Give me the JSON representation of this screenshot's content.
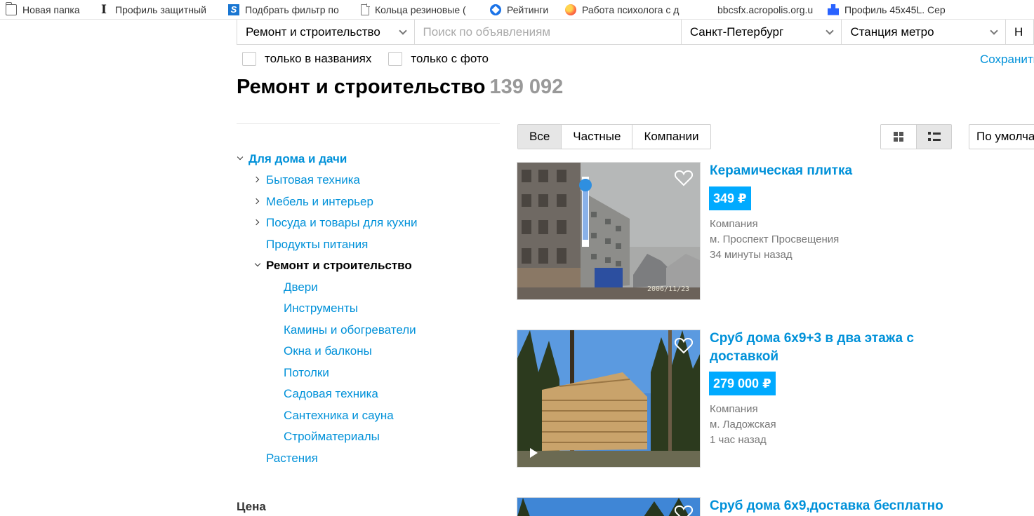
{
  "bookmarks": [
    {
      "label": "Новая папка",
      "icon": "folder-icon"
    },
    {
      "label": "Профиль защитный",
      "icon": "i-beam-icon"
    },
    {
      "label": "Подбрать фильтр по",
      "icon": "s-logo-icon"
    },
    {
      "label": "Кольца резиновые (",
      "icon": "document-icon"
    },
    {
      "label": "Рейтинги",
      "icon": "ratings-icon"
    },
    {
      "label": "Работа психолога с д",
      "icon": "ball-icon"
    },
    {
      "label": "bbcsfx.acropolis.org.u",
      "icon": "none"
    },
    {
      "label": "Профиль 45х45L. Сер",
      "icon": "puzzle-icon"
    }
  ],
  "search": {
    "category": "Ремонт и строительство",
    "placeholder": "Поиск по объявлениям",
    "city": "Санкт-Петербург",
    "metro": "Станция метро",
    "extra": "Н"
  },
  "filters": {
    "titles_only": "только в названиях",
    "with_photo": "только с фото",
    "save_search": "Сохранить"
  },
  "page": {
    "title": "Ремонт и строительство",
    "count": "139 092"
  },
  "sidebar": {
    "parent": "Для дома и дачи",
    "items": [
      {
        "label": "Бытовая техника"
      },
      {
        "label": "Мебель и интерьер"
      },
      {
        "label": "Посуда и товары для кухни"
      },
      {
        "label": "Продукты питания"
      },
      {
        "label": "Ремонт и строительство"
      },
      {
        "label": "Растения"
      }
    ],
    "subitems": [
      {
        "label": "Двери"
      },
      {
        "label": "Инструменты"
      },
      {
        "label": "Камины и обогреватели"
      },
      {
        "label": "Окна и балконы"
      },
      {
        "label": "Потолки"
      },
      {
        "label": "Садовая техника"
      },
      {
        "label": "Сантехника и сауна"
      },
      {
        "label": "Стройматериалы"
      }
    ],
    "price_label": "Цена"
  },
  "tabs": [
    {
      "label": "Все",
      "active": true
    },
    {
      "label": "Частные",
      "active": false
    },
    {
      "label": "Компании",
      "active": false
    }
  ],
  "sort": {
    "value": "По умолча"
  },
  "listings": [
    {
      "title": "Керамическая плитка",
      "price": "349 ₽",
      "seller": "Компания",
      "metro": "м. Проспект Просвещения",
      "time": "34 минуты назад",
      "photo_date": "2006/11/23"
    },
    {
      "title": "Сруб дома 6х9+3 в два этажа с доставкой",
      "price": "279 000 ₽",
      "seller": "Компания",
      "metro": "м. Ладожская",
      "time": "1 час назад"
    },
    {
      "title": "Сруб дома 6х9,доставка бесплатно"
    }
  ],
  "colors": {
    "link": "#0091d9",
    "price_bg": "#00aaff",
    "muted": "#999999"
  }
}
